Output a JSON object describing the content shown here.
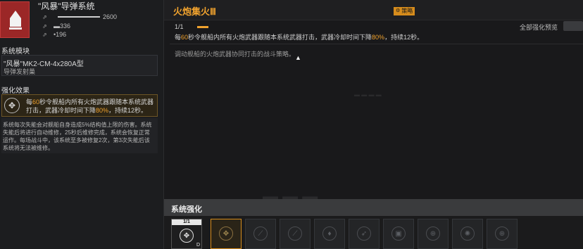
{
  "module": {
    "name": "\"风暴\"导弹系统",
    "stats": [
      {
        "icon": "fire-rate-icon",
        "value": "2600",
        "fill": 1.0
      },
      {
        "icon": "damage-icon",
        "value": "336",
        "fill": 0
      },
      {
        "icon": "range-icon",
        "value": "196",
        "fill": 0
      }
    ],
    "color": "#9b2727"
  },
  "left": {
    "system_module_label": "系统模块",
    "module_model": "\"风暴\"MK2-CM-4x280A型",
    "module_type": "导弹发射巢",
    "enhance_effect_label": "强化效果",
    "effect_part1": "每",
    "effect_num1": "60",
    "effect_part2": "秒令舰船内所有火炮武器跟随本系统武器打击，武器冷却时间下降",
    "effect_num2": "80%",
    "effect_part3": "，持续12秒。",
    "description": "系统每次失能会对舰船自身造成5%结构值上限的伤害。系统失能后将进行自动维修，25秒后维修完成，系统会恢复正常运作。每场战斗中，该系统至多被修复2次，第3次失能后该系统将无法被维修。"
  },
  "detail": {
    "title": "火炮集火Ⅲ",
    "strategy_tag": "策略",
    "level": "1/1",
    "preview_label": "全部强化预览",
    "effect_part1": "每",
    "effect_num1": "60",
    "effect_part2": "秒令舰船内所有火炮武器跟随本系统武器打击，武器冷却时间下降",
    "effect_num2": "80%",
    "effect_part3": "，持续12秒。",
    "description": "调动舰船的火炮武器协同打击的战斗策略。",
    "accent": "#f0a22e"
  },
  "bottom": {
    "title": "系统强化",
    "current_level": "1/1",
    "current_grade": "D",
    "slots": [
      {
        "icon": "artillery-focus-icon"
      },
      {
        "icon": "missile-icon"
      },
      {
        "icon": "missile-icon"
      },
      {
        "icon": "shell-icon"
      },
      {
        "icon": "rocket-icon"
      },
      {
        "icon": "circuit-icon"
      },
      {
        "icon": "target-icon"
      },
      {
        "icon": "scatter-icon"
      },
      {
        "icon": "target-icon"
      }
    ]
  }
}
